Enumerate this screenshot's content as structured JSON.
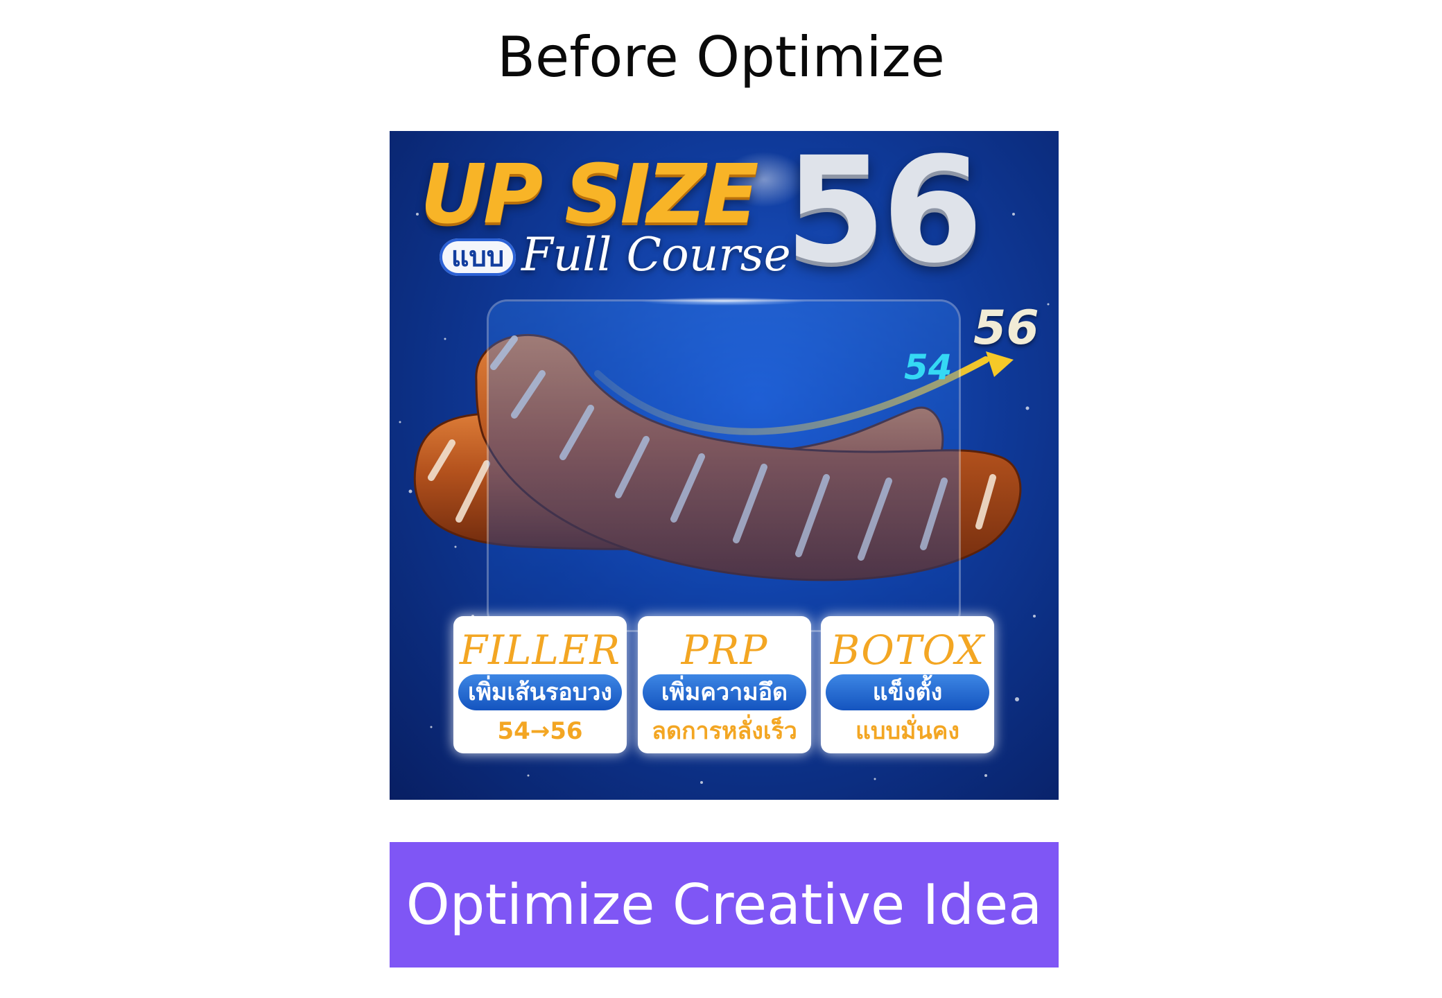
{
  "header": {
    "title": "Before Optimize"
  },
  "creative": {
    "headline": "UP SIZE",
    "big_number": "56",
    "tag_pill": "แบบ",
    "tag_script": "Full Course",
    "arrow_label_from": "54",
    "arrow_label_to": "56",
    "cards": [
      {
        "title": "FILLER",
        "pill": "เพิ่มเส้นรอบวง",
        "sub": "54→56"
      },
      {
        "title": "PRP",
        "pill": "เพิ่มความอึด",
        "sub": "ลดการหลั่งเร็ว"
      },
      {
        "title": "BOTOX",
        "pill": "แข็งตั้ง",
        "sub": "แบบมั่นคง"
      }
    ],
    "colors": {
      "background": "#0f3a9a",
      "headline": "#f8b427",
      "accent_cyan": "#35d9f4",
      "card_text": "#f3a623"
    }
  },
  "cta": {
    "label": "Optimize Creative Idea",
    "color": "#7f56f5"
  }
}
